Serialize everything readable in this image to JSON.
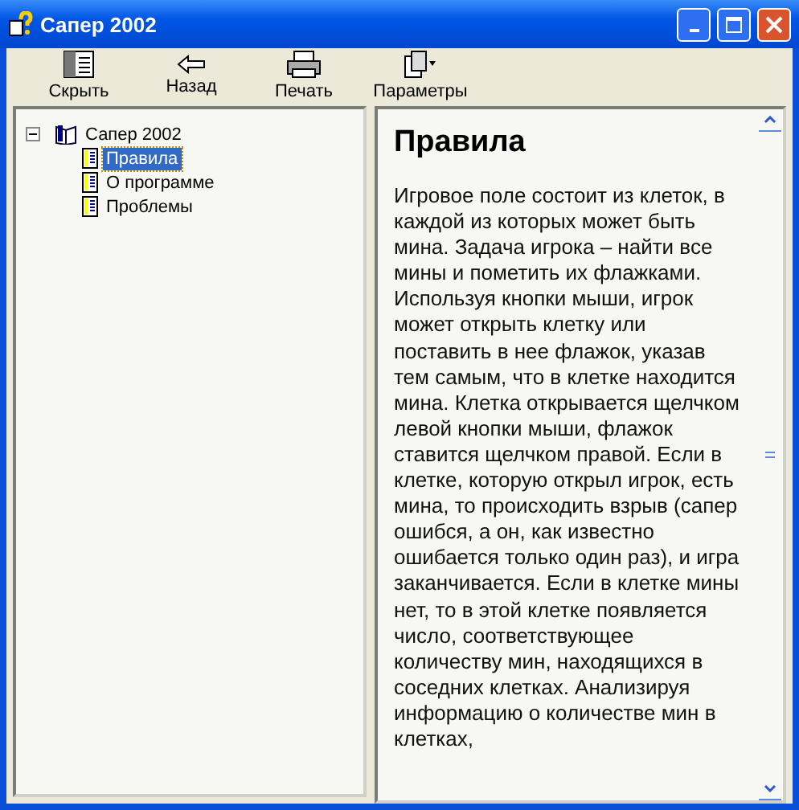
{
  "window": {
    "title": "Сапер 2002"
  },
  "toolbar": [
    {
      "label": "Скрыть",
      "kind": "hide"
    },
    {
      "label": "Назад",
      "kind": "back"
    },
    {
      "label": "Печать",
      "kind": "print"
    },
    {
      "label": "Параметры",
      "kind": "options"
    }
  ],
  "tree": {
    "label": "Сапер 2002",
    "expanded": true,
    "children": [
      {
        "label": "Правила",
        "selected": true
      },
      {
        "label": "О программе",
        "selected": false
      },
      {
        "label": "Проблемы",
        "selected": false
      }
    ]
  },
  "article": {
    "heading": "Правила",
    "text": "Игровое поле состоит из клеток, в каждой из которых может быть мина. Задача игрока – найти все мины и пометить их флажками. Используя кнопки мыши, игрок может открыть клетку или поставить в нее флажок, указав тем самым, что в клетке находится мина. Клетка открывается щелчком левой кнопки мыши, флажок ставится щелчком правой. Если в клетке, которую открыл игрок, есть мина, то происходить взрыв (сапер ошибся, а он, как известно ошибается только один раз), и игра заканчивается. Если в клетке мины нет, то в этой клетке появляется число, соответствующее количеству мин, находящихся в соседних клетках. Анализируя информацию о количестве мин в клетках,"
  }
}
